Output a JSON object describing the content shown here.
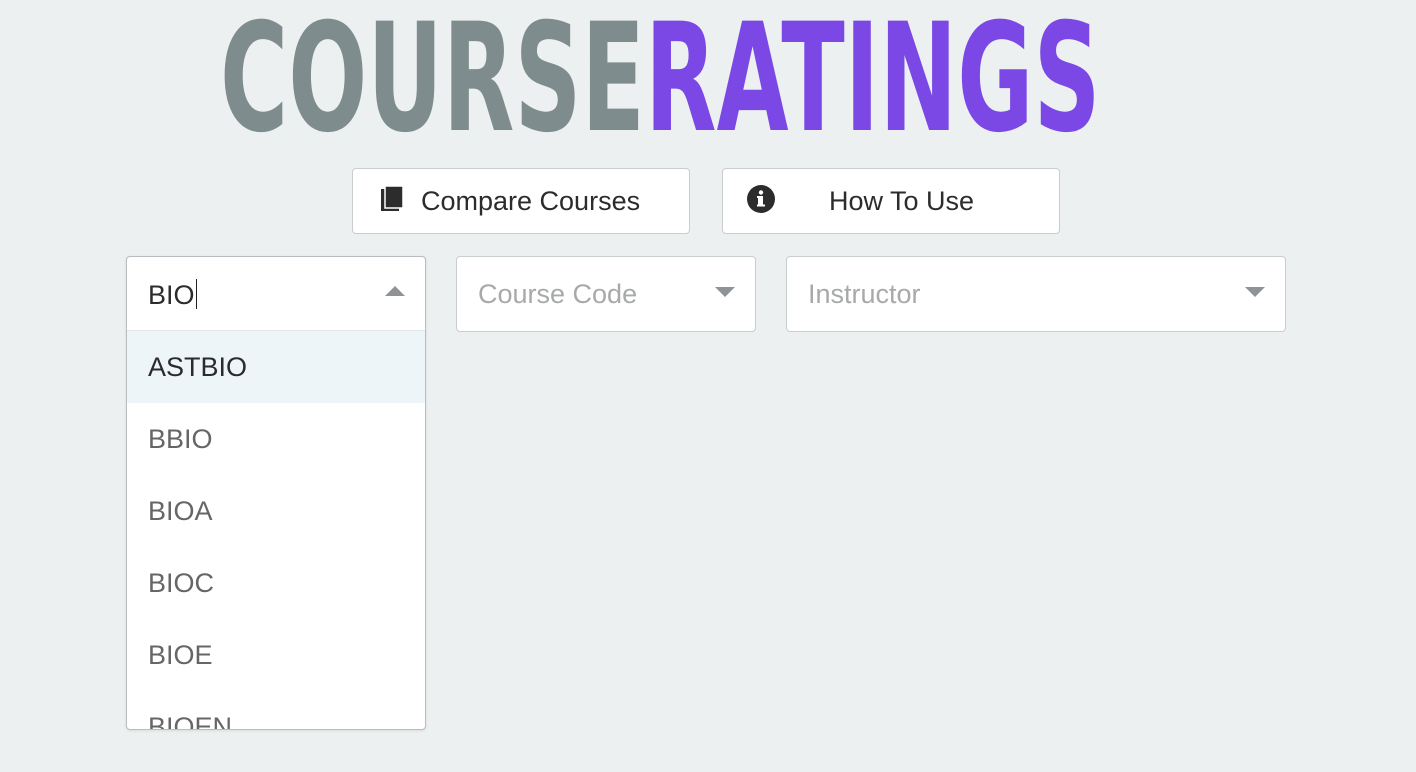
{
  "logo": {
    "part1": "COURSE",
    "part2": "RATINGS",
    "color1": "#7f8c8d",
    "color2": "#7b48e5"
  },
  "buttons": {
    "compare": {
      "label": "Compare Courses",
      "icon": "book-icon"
    },
    "howto": {
      "label": "How To Use",
      "icon": "info-circle-icon"
    }
  },
  "subject_select": {
    "value": "BIO",
    "expanded": true,
    "options": [
      "ASTBIO",
      "BBIO",
      "BIOA",
      "BIOC",
      "BIOE",
      "BIOEN"
    ],
    "focused_option": "ASTBIO"
  },
  "course_select": {
    "placeholder": "Course Code"
  },
  "instructor_select": {
    "placeholder": "Instructor"
  },
  "colors": {
    "background": "#ecf0f1",
    "accent": "#7b48e5"
  }
}
